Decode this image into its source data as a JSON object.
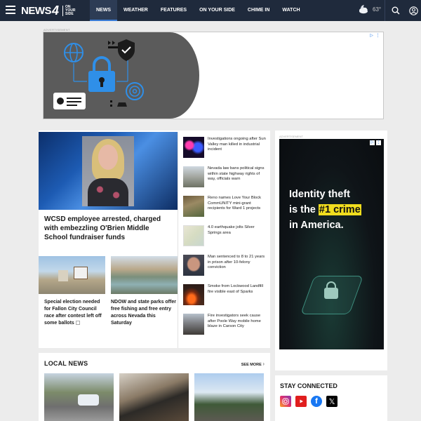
{
  "header": {
    "logo": {
      "word": "NEWS",
      "number": "4",
      "sub": "ON\nYOUR\nSIDE"
    },
    "nav": [
      "NEWS",
      "WEATHER",
      "FEATURES",
      "ON YOUR SIDE",
      "CHIME IN",
      "WATCH"
    ],
    "active_nav": "NEWS",
    "weather": {
      "icon": "partly-cloudy-night-icon",
      "temp": "63°"
    }
  },
  "ads": {
    "label": "ADVERTISEMENT"
  },
  "right_ad": {
    "line1": "Identity theft",
    "line2_pre": "is the ",
    "line2_highlight": "#1 crime",
    "line3": "in America."
  },
  "hero": {
    "title": "WCSD employee arrested, charged with embezzling O'Brien Middle School fundraiser funds"
  },
  "sub_stories": [
    {
      "title": "Special election needed for Fallon City Council race after contest left off some ballots"
    },
    {
      "title": "NDOW and state parks offer free fishing and free entry across Nevada this Saturday"
    }
  ],
  "list_stories": [
    {
      "title": "Investigations ongoing after Sun Valley man killed in industrial incident"
    },
    {
      "title": "Nevada law bans political signs within state highway rights of way, officials warn"
    },
    {
      "title": "Reno names Love Your Block CommUNITY mini-grant recipients for Ward 1 projects"
    },
    {
      "title": "4.0 earthquake jolts Silver Springs area"
    },
    {
      "title": "Man sentenced to 8 to 21 years in prison after 10-felony conviction"
    },
    {
      "title": "Smoke from Lockwood Landfill fire visible east of Sparks"
    },
    {
      "title": "Fire investigators seek cause after Poole Way mobile home blaze in Carson City"
    }
  ],
  "local_news": {
    "title": "LOCAL NEWS",
    "see_more": "SEE MORE"
  },
  "stay_connected": {
    "title": "STAY CONNECTED",
    "networks": [
      "instagram",
      "youtube",
      "facebook",
      "x"
    ]
  },
  "colors": {
    "header_bg": "#1f2a3c",
    "accent": "#3a7bd5",
    "ad_highlight": "#f1de1e"
  }
}
